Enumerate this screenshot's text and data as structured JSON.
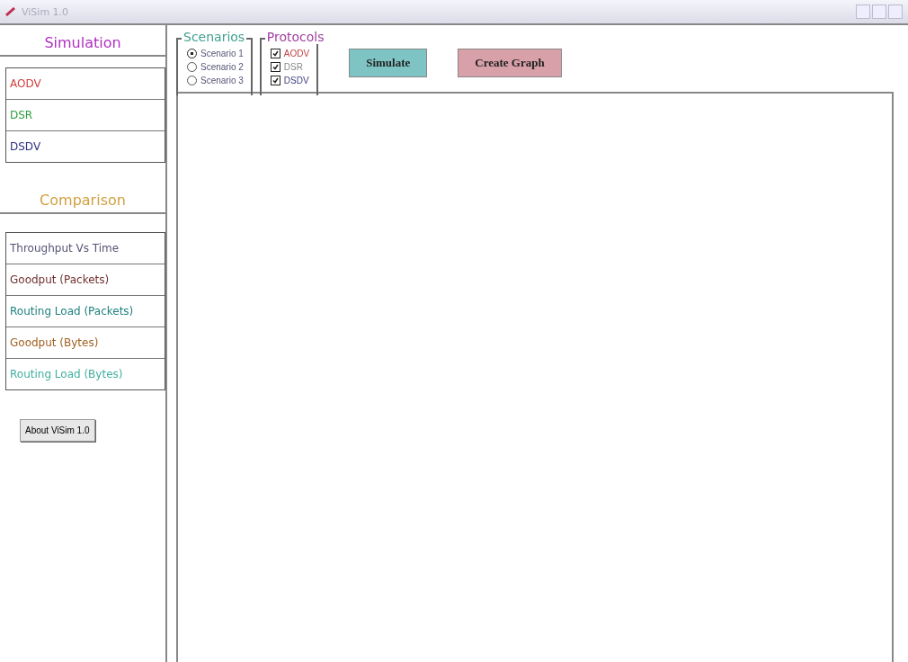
{
  "window": {
    "title": "ViSim 1.0"
  },
  "sidebar": {
    "simulation_heading": "Simulation",
    "simulation_items": [
      {
        "label": "AODV",
        "color": "#d04040"
      },
      {
        "label": "DSR",
        "color": "#30a040"
      },
      {
        "label": "DSDV",
        "color": "#303080"
      }
    ],
    "comparison_heading": "Comparison",
    "comparison_items": [
      {
        "label": "Throughput Vs Time",
        "color": "#555577"
      },
      {
        "label": "Goodput (Packets)",
        "color": "#703030"
      },
      {
        "label": "Routing Load (Packets)",
        "color": "#208080"
      },
      {
        "label": "Goodput (Bytes)",
        "color": "#a06020"
      },
      {
        "label": "Routing Load (Bytes)",
        "color": "#40b0a0"
      }
    ],
    "about_button": "About ViSim 1.0"
  },
  "scenarios": {
    "title": "Scenarios",
    "options": [
      {
        "label": "Scenario 1",
        "selected": true
      },
      {
        "label": "Scenario 2",
        "selected": false
      },
      {
        "label": "Scenario 3",
        "selected": false
      }
    ]
  },
  "protocols": {
    "title": "Protocols",
    "options": [
      {
        "label": "AODV",
        "checked": true,
        "color": "#c04040"
      },
      {
        "label": "DSR",
        "checked": true,
        "color": "#888888"
      },
      {
        "label": "DSDV",
        "checked": true,
        "color": "#404080"
      }
    ]
  },
  "buttons": [
    {
      "label": "Simulate",
      "color": "#7fc4c4"
    },
    {
      "label": "Create Graph",
      "color": "#d8a0a8"
    }
  ]
}
